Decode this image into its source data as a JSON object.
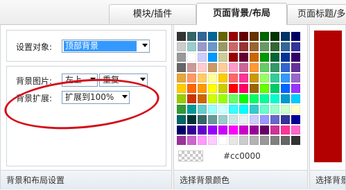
{
  "tabs": [
    {
      "label": "模块/插件",
      "active": false
    },
    {
      "label": "页面背景/布局",
      "active": true
    },
    {
      "label": "页面标题/多",
      "active": false
    }
  ],
  "layout_panel": {
    "target_label": "设置对象:",
    "target_value": "顶部背景",
    "image_label": "背景图片:",
    "image_position": "左上",
    "image_repeat": "重复",
    "expand_label": "背景扩展:",
    "expand_value": "扩展到100%",
    "footer": "背景和布局设置"
  },
  "color_panel": {
    "footer": "选择背景颜色",
    "selected_hex": "#cc0000",
    "swatches": [
      "#333333",
      "#336666",
      "#336699",
      "#006699",
      "#666600",
      "#990000",
      "#660000",
      "#663300",
      "#006600",
      "#003300",
      "#003366",
      "#000066",
      "#cccccc",
      "#99cccc",
      "#9999cc",
      "#6699cc",
      "#999966",
      "#cc6666",
      "#993333",
      "#996633",
      "#669966",
      "#336633",
      "#336699",
      "#333399",
      "#999999",
      "#ffffff",
      "#ccccff",
      "#0099ff",
      "#cccc99",
      "#990000",
      "#660033",
      "#cc6600",
      "#009900",
      "#006633",
      "#003399",
      "#330066",
      "#666666",
      "#cc9999",
      "#ffcccc",
      "#cc9966",
      "#ffcc99",
      "#ff99cc",
      "#cc6699",
      "#ff9933",
      "#66cc66",
      "#339966",
      "#3366cc",
      "#663399",
      "#e6a83a",
      "#ff9966",
      "#ffcc66",
      "#ffff99",
      "#ffcc00",
      "#ff6666",
      "#ff3399",
      "#cc9900",
      "#99ff66",
      "#33cc99",
      "#3399ff",
      "#9966cc",
      "#ffcc00",
      "#ff6600",
      "#ff9900",
      "#ffff00",
      "#cccc00",
      "#ff0000",
      "#ff0066",
      "#996600",
      "#66ff00",
      "#00cc66",
      "#0066ff",
      "#9933ff",
      "#99cc00",
      "#cc3300",
      "#cc6600",
      "#ccff00",
      "#99ff00",
      "#66ff66",
      "#00ff00",
      "#00ff66",
      "#00ff99",
      "#00ffcc",
      "#0099cc",
      "#00ccff",
      "#339933",
      "#009999",
      "#66cccc",
      "#99ffff",
      "#ccffff",
      "#33ffff",
      "#00ffff",
      "#33cccc",
      "#66ffcc",
      "#99ffcc",
      "#ccffcc",
      "#ffffcc",
      "#006666",
      "#003333",
      "#336666",
      "#669999",
      "#99cccc",
      "#cce6e6",
      "#e6f2f2",
      "#ccccff",
      "#9999ff",
      "#6666cc",
      "#333399",
      "#000099",
      "#000066",
      "#330099",
      "#6600cc",
      "#9900ff",
      "#cc00ff",
      "#ff00ff",
      "#cc00cc",
      "#990099",
      "#660066",
      "#cc3399",
      "#ff3399",
      "#ff66cc",
      "#993399",
      "#cc66cc",
      "#ff99ff",
      "#ffccff",
      "#ffffff",
      "#e6e6e6",
      "#cccccc",
      "#b3b3b3",
      "#999999",
      "#808080",
      "#666666",
      "#333333"
    ]
  },
  "right_panel": {
    "footer": "选择背景",
    "preview_color": "#b30000"
  }
}
